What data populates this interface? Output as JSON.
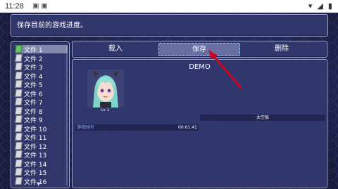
{
  "statusbar": {
    "time": "11:28",
    "notif": "▣ ▣"
  },
  "message": "保存目前的游戏进度。",
  "commands": {
    "load": "载入",
    "save": "保存",
    "delete": "删除"
  },
  "files": [
    {
      "label": "文件 1"
    },
    {
      "label": "文件 2"
    },
    {
      "label": "文件 3"
    },
    {
      "label": "文件 4"
    },
    {
      "label": "文件 5"
    },
    {
      "label": "文件 6"
    },
    {
      "label": "文件 7"
    },
    {
      "label": "文件 8"
    },
    {
      "label": "文件 9"
    },
    {
      "label": "文件 10"
    },
    {
      "label": "文件 11"
    },
    {
      "label": "文件 12"
    },
    {
      "label": "文件 13"
    },
    {
      "label": "文件 14"
    },
    {
      "label": "文件 15"
    },
    {
      "label": "文件 16"
    }
  ],
  "selected_file_index": 0,
  "save_info": {
    "title": "DEMO",
    "level": "Lv 1",
    "playtime_label": "游戏时间",
    "playtime_value": "00:01:41",
    "location": "太空船"
  },
  "colors": {
    "accent_arrow": "#d0021b",
    "panel_border": "#aab4e0"
  }
}
